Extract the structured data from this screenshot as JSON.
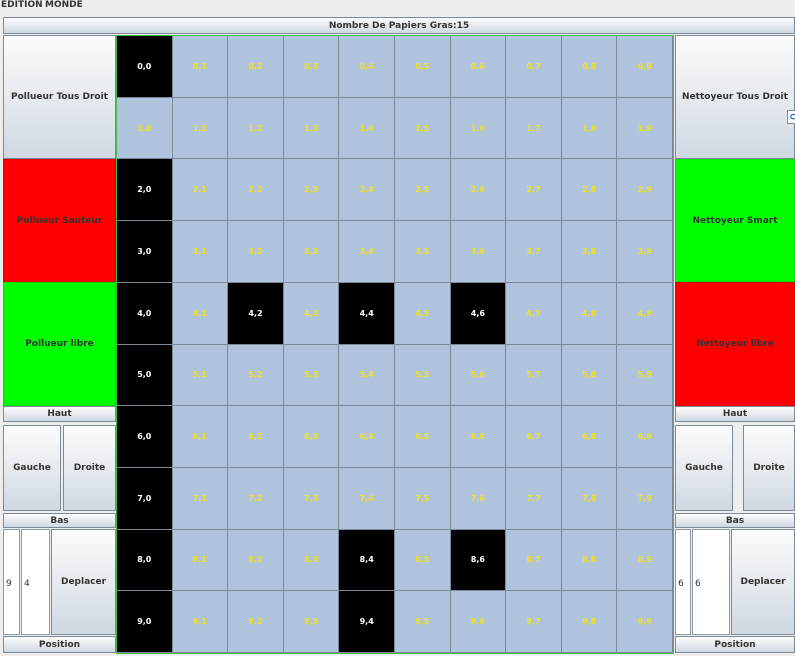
{
  "menu": {
    "edition": "EDITION",
    "monde": "MONDE"
  },
  "header": {
    "title": "Nombre De Papiers Gras:15"
  },
  "left_panel": {
    "pollueur_tous_droit": "Pollueur Tous Droit",
    "pollueur_sauteur": "Pollueur Sauteur",
    "pollueur_libre": "Pollueur libre",
    "haut": "Haut",
    "gauche": "Gauche",
    "droite": "Droite",
    "bas": "Bas",
    "x_value": "9",
    "y_value": "4",
    "deplacer": "Deplacer",
    "position": "Position"
  },
  "right_panel": {
    "nettoyeur_tous_droit": "Nettoyeur Tous Droit",
    "nettoyeur_smart": "Nettoyeur Smart",
    "nettoyeur_libre": "Nettoyeur libre",
    "haut": "Haut",
    "gauche": "Gauche",
    "droite": "Droite",
    "bas": "Bas",
    "x_value": "6",
    "y_value": "6",
    "deplacer": "Deplacer",
    "position": "Position"
  },
  "colors": {
    "active_green": "#00ff00",
    "inactive_red": "#ff0000",
    "cell_empty": "#b0c4de",
    "cell_dirty": "#000000",
    "cell_label_empty": "#f0e020",
    "cell_label_dirty": "#ffffff"
  },
  "grid": {
    "rows": 10,
    "cols": 10,
    "black_cells": [
      "0,0",
      "2,0",
      "3,0",
      "4,0",
      "4,2",
      "4,4",
      "4,6",
      "5,0",
      "6,0",
      "7,0",
      "8,0",
      "8,4",
      "8,6",
      "9,0",
      "9,4"
    ]
  },
  "icons": {
    "edge_icon": "expand-icon"
  }
}
